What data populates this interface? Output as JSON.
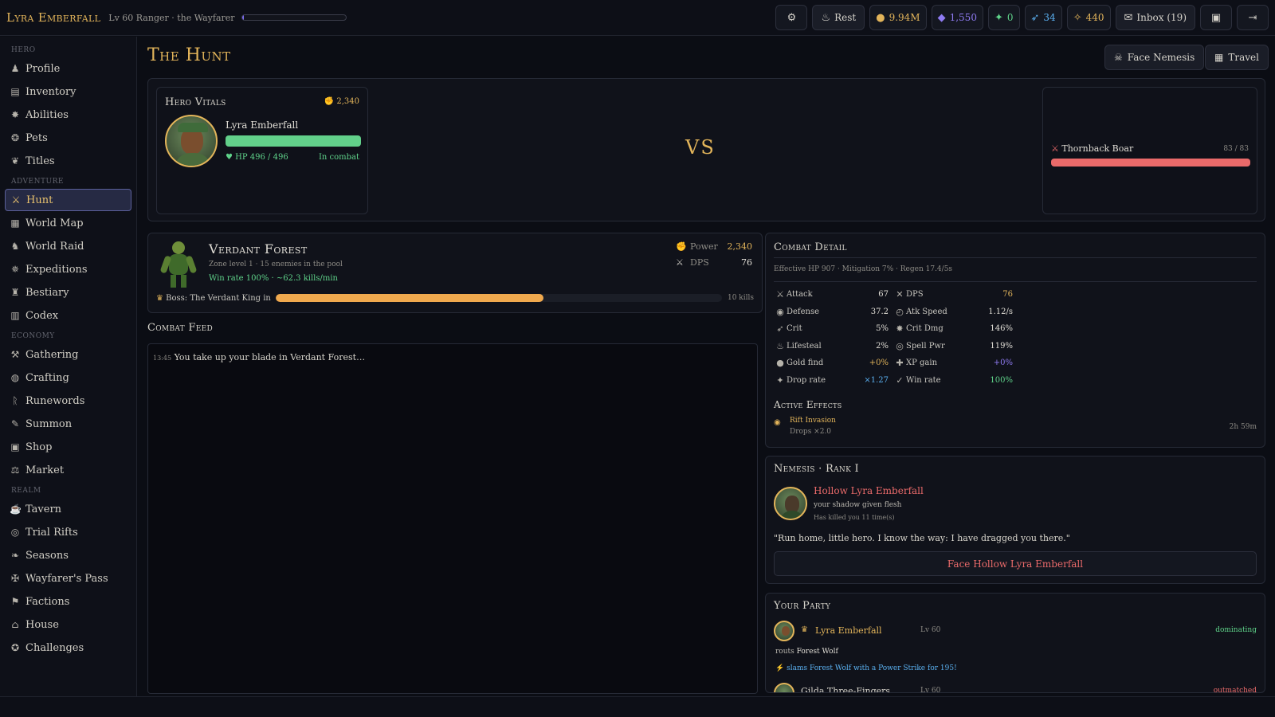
{
  "topbar": {
    "brand": "Lyra Emberfall",
    "subtitle": "Lv 60 Ranger · the Wayfarer",
    "xp_fraction": 0.02,
    "rest_label": "Rest",
    "gold": "9.94M",
    "gems": "1,550",
    "shards": "0",
    "feathers": "34",
    "sparks": "440",
    "inbox_label": "Inbox (19)"
  },
  "sidebar": {
    "sections": [
      "Hero",
      "Adventure",
      "Economy",
      "Realm"
    ],
    "items": [
      {
        "label": "Profile",
        "icon": "user-icon"
      },
      {
        "label": "Inventory",
        "icon": "backpack-icon"
      },
      {
        "label": "Abilities",
        "icon": "abilities-icon"
      },
      {
        "label": "Pets",
        "icon": "paw-icon"
      },
      {
        "label": "Titles",
        "icon": "laurel-icon"
      },
      {
        "label": "Hunt",
        "icon": "crossed-swords-icon"
      },
      {
        "label": "World Map",
        "icon": "map-icon"
      },
      {
        "label": "World Raid",
        "icon": "dragon-icon"
      },
      {
        "label": "Expeditions",
        "icon": "compass-icon"
      },
      {
        "label": "Bestiary",
        "icon": "beast-icon"
      },
      {
        "label": "Codex",
        "icon": "book-icon"
      },
      {
        "label": "Gathering",
        "icon": "pickaxe-icon"
      },
      {
        "label": "Crafting",
        "icon": "anvil-icon"
      },
      {
        "label": "Runewords",
        "icon": "rune-icon"
      },
      {
        "label": "Summon",
        "icon": "wand-icon"
      },
      {
        "label": "Shop",
        "icon": "shop-icon"
      },
      {
        "label": "Market",
        "icon": "scale-icon"
      },
      {
        "label": "Tavern",
        "icon": "mug-icon"
      },
      {
        "label": "Trial Rifts",
        "icon": "portal-icon"
      },
      {
        "label": "Seasons",
        "icon": "leaf-icon"
      },
      {
        "label": "Wayfarer's Pass",
        "icon": "ticket-icon"
      },
      {
        "label": "Factions",
        "icon": "flag-icon"
      },
      {
        "label": "House",
        "icon": "house-icon"
      },
      {
        "label": "Challenges",
        "icon": "trophy-icon"
      }
    ]
  },
  "page": {
    "title": "The Hunt",
    "face_nemesis_label": "Face Nemesis",
    "travel_label": "Travel"
  },
  "vitals": {
    "title": "Hero Vitals",
    "power": "2,340",
    "hero_name": "Lyra Emberfall",
    "hp_text": "HP 496 / 496",
    "hp_fraction": 1.0,
    "status": "In combat",
    "vs": "VS",
    "enemy_name": "Thornback Boar",
    "enemy_hp": "83 / 83",
    "enemy_hp_fraction": 1.0
  },
  "zone": {
    "name": "Verdant Forest",
    "desc": "Zone level 1 · 15 enemies in the pool",
    "winrate": "Win rate 100% · ~62.3 kills/min",
    "power_label": "Power",
    "power_value": "2,340",
    "dps_label": "DPS",
    "dps_value": "76",
    "boss_label": "Boss: The Verdant King in",
    "boss_fraction": 0.6,
    "boss_kills": "10 kills"
  },
  "feed": {
    "title": "Combat Feed",
    "entries": [
      {
        "time": "13:45",
        "text": "You take up your blade in Verdant Forest…"
      }
    ]
  },
  "combat_detail": {
    "title": "Combat Detail",
    "summary": "Effective HP 907 · Mitigation 7% · Regen 17.4/5s",
    "rows": [
      {
        "l1": "Attack",
        "v1": "67",
        "l2": "DPS",
        "v2": "76"
      },
      {
        "l1": "Defense",
        "v1": "37.2",
        "l2": "Atk Speed",
        "v2": "1.12/s"
      },
      {
        "l1": "Crit",
        "v1": "5%",
        "l2": "Crit Dmg",
        "v2": "146%"
      },
      {
        "l1": "Lifesteal",
        "v1": "2%",
        "l2": "Spell Pwr",
        "v2": "119%"
      },
      {
        "l1": "Gold find",
        "v1": "+0%",
        "l2": "XP gain",
        "v2": "+0%"
      },
      {
        "l1": "Drop rate",
        "v1": "×1.27",
        "l2": "Win rate",
        "v2": "100%"
      }
    ],
    "effects_title": "Active Effects",
    "effect_name": "Rift Invasion",
    "effect_desc": "Drops ×2.0",
    "effect_time": "2h 59m"
  },
  "nemesis": {
    "title": "Nemesis · Rank I",
    "name": "Hollow Lyra Emberfall",
    "tagline": "your shadow given flesh",
    "kills": "Has killed you 11 time(s)",
    "quote": "\"Run home, little hero. I know the way: I have dragged you there.\"",
    "button": "Face Hollow Lyra Emberfall"
  },
  "party": {
    "title": "Your Party",
    "member_name": "Lyra Emberfall",
    "member_level": "Lv 60",
    "member_status": "dominating",
    "action_prefix": "routs",
    "action_target": "Forest Wolf",
    "strike_text": "slams Forest Wolf with a Power Strike for 195!",
    "member2_name": "Gilda Three-Fingers",
    "member2_level": "Lv 60",
    "member2_status": "outmatched"
  },
  "colors": {
    "accent_gold": "#e2b45a",
    "hp_green": "#62d08a",
    "enemy_red": "#ea6a6a",
    "boss_orange": "#f0a94e",
    "xp_purple": "#7c6cf0"
  }
}
